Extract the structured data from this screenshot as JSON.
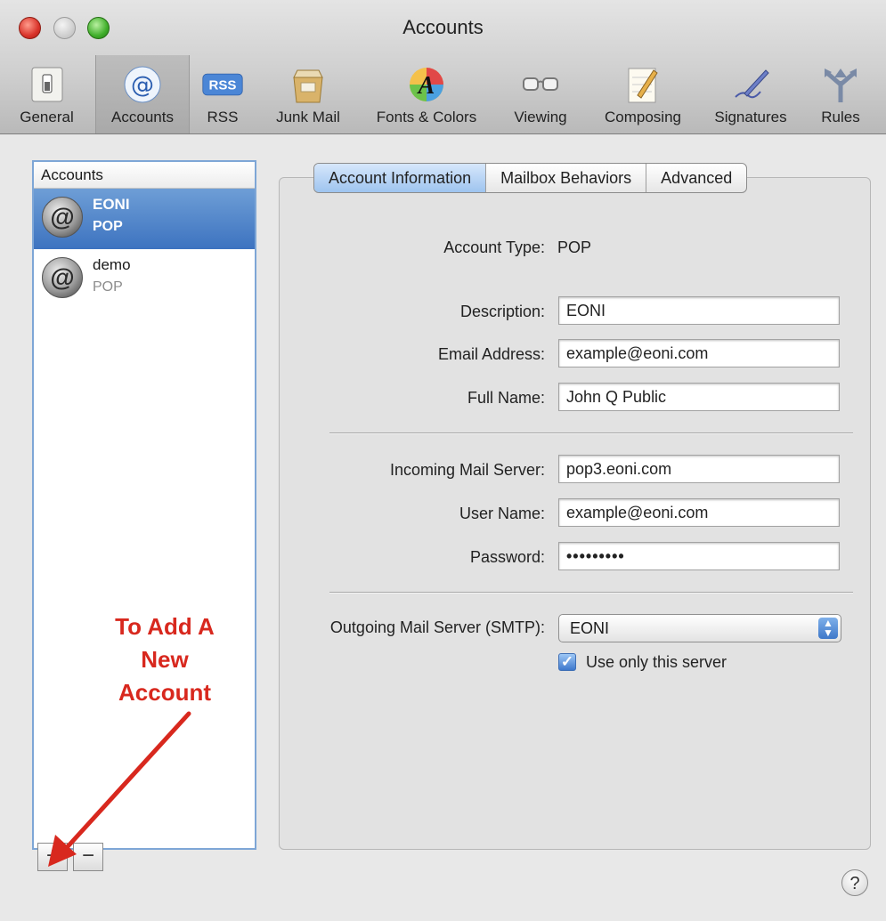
{
  "window": {
    "title": "Accounts"
  },
  "toolbar": {
    "items": [
      {
        "label": "General",
        "icon": "switch-icon"
      },
      {
        "label": "Accounts",
        "icon": "at-sign-icon",
        "selected": true
      },
      {
        "label": "RSS",
        "icon": "rss-icon"
      },
      {
        "label": "Junk Mail",
        "icon": "junk-mail-icon"
      },
      {
        "label": "Fonts & Colors",
        "icon": "fonts-colors-icon"
      },
      {
        "label": "Viewing",
        "icon": "glasses-icon"
      },
      {
        "label": "Composing",
        "icon": "notepad-pencil-icon"
      },
      {
        "label": "Signatures",
        "icon": "pen-signature-icon"
      },
      {
        "label": "Rules",
        "icon": "rules-arrows-icon"
      }
    ],
    "rss_badge": "RSS",
    "fonts_glyph": "A",
    "accounts_glyph": "@"
  },
  "accounts_list": {
    "header": "Accounts",
    "items": [
      {
        "name": "EONI",
        "type": "POP",
        "selected": true
      },
      {
        "name": "demo",
        "type": "POP",
        "selected": false
      }
    ],
    "avatar_glyph": "@",
    "add_label": "+",
    "remove_label": "−"
  },
  "tabs": [
    {
      "label": "Account Information",
      "active": true
    },
    {
      "label": "Mailbox Behaviors",
      "active": false
    },
    {
      "label": "Advanced",
      "active": false
    }
  ],
  "form": {
    "account_type_label": "Account Type:",
    "account_type_value": "POP",
    "description_label": "Description:",
    "description_value": "EONI",
    "email_label": "Email Address:",
    "email_value": "example@eoni.com",
    "full_name_label": "Full Name:",
    "full_name_value": "John Q Public",
    "incoming_label": "Incoming Mail Server:",
    "incoming_value": "pop3.eoni.com",
    "username_label": "User Name:",
    "username_value": "example@eoni.com",
    "password_label": "Password:",
    "password_value": "•••••••••",
    "smtp_label": "Outgoing Mail Server (SMTP):",
    "smtp_value": "EONI",
    "use_only_label": "Use only this server",
    "use_only_checked": true
  },
  "annotation": {
    "text_line1": "To Add A",
    "text_line2": "New",
    "text_line3": "Account",
    "color": "#d8281e"
  },
  "help_label": "?"
}
